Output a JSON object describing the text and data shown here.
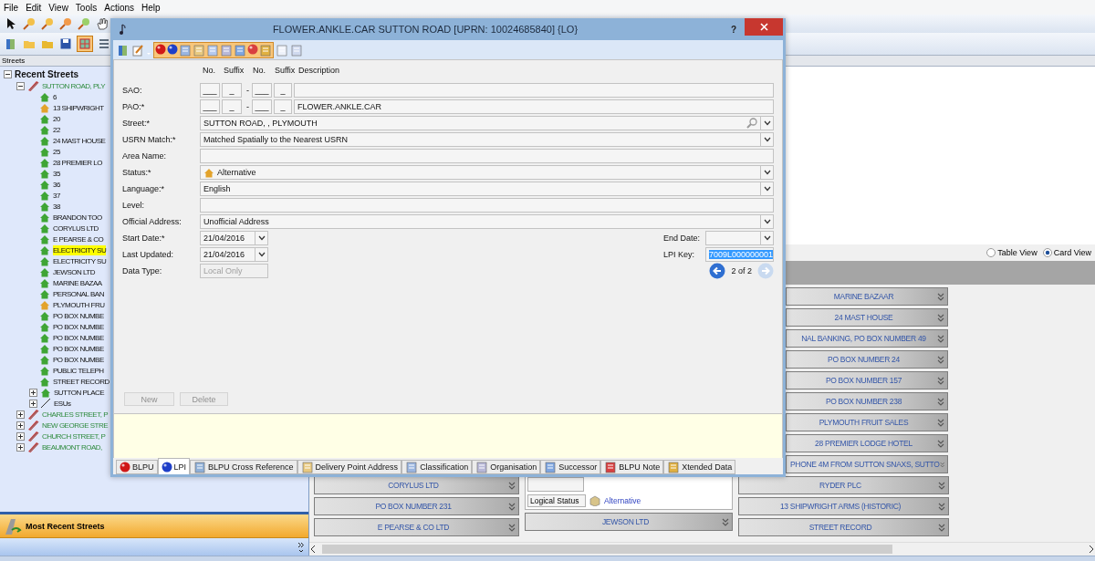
{
  "menu": [
    "File",
    "Edit",
    "View",
    "Tools",
    "Actions",
    "Help"
  ],
  "left_panel": {
    "title": "Streets",
    "tree": {
      "label": "Recent Streets",
      "expanded": true,
      "children": [
        {
          "label": "SUTTON ROAD, PLY",
          "kind": "street",
          "expanded": true,
          "children": [
            {
              "label": "6",
              "kind": "property",
              "color": "#3fa535",
              "selected": false
            },
            {
              "label": "13 SHIPWRIGHT",
              "kind": "property",
              "color": "#e3a32c",
              "selected": false
            },
            {
              "label": "20",
              "kind": "property",
              "color": "#3fa535",
              "selected": false
            },
            {
              "label": "22",
              "kind": "property",
              "color": "#3fa535",
              "selected": false
            },
            {
              "label": "24 MAST HOUSE",
              "kind": "property",
              "color": "#3fa535",
              "selected": false
            },
            {
              "label": "25",
              "kind": "property",
              "color": "#3fa535",
              "selected": false
            },
            {
              "label": "28 PREMIER LO",
              "kind": "property",
              "color": "#3fa535",
              "selected": false
            },
            {
              "label": "35",
              "kind": "property",
              "color": "#3fa535",
              "selected": false
            },
            {
              "label": "36",
              "kind": "property",
              "color": "#3fa535",
              "selected": false
            },
            {
              "label": "37",
              "kind": "property",
              "color": "#3fa535",
              "selected": false
            },
            {
              "label": "38",
              "kind": "property",
              "color": "#3fa535",
              "selected": false
            },
            {
              "label": "BRANDON TOO",
              "kind": "property",
              "color": "#3fa535",
              "selected": false
            },
            {
              "label": "CORYLUS LTD",
              "kind": "property",
              "color": "#3fa535",
              "selected": false
            },
            {
              "label": "E PEARSE & CO",
              "kind": "property",
              "color": "#3fa535",
              "selected": false
            },
            {
              "label": "ELECTRICITY SU",
              "kind": "property",
              "color": "#3fa535",
              "selected": true
            },
            {
              "label": "ELECTRICITY SU",
              "kind": "property",
              "color": "#3fa535",
              "selected": false
            },
            {
              "label": "JEWSON LTD",
              "kind": "property",
              "color": "#3fa535",
              "selected": false
            },
            {
              "label": "MARINE BAZAA",
              "kind": "property",
              "color": "#3fa535",
              "selected": false
            },
            {
              "label": "PERSONAL BAN",
              "kind": "property",
              "color": "#3fa535",
              "selected": false
            },
            {
              "label": "PLYMOUTH FRU",
              "kind": "property",
              "color": "#e3a32c",
              "selected": false
            },
            {
              "label": "PO BOX NUMBE",
              "kind": "property",
              "color": "#3fa535",
              "selected": false
            },
            {
              "label": "PO BOX NUMBE",
              "kind": "property",
              "color": "#3fa535",
              "selected": false
            },
            {
              "label": "PO BOX NUMBE",
              "kind": "property",
              "color": "#3fa535",
              "selected": false
            },
            {
              "label": "PO BOX NUMBE",
              "kind": "property",
              "color": "#3fa535",
              "selected": false
            },
            {
              "label": "PO BOX NUMBE",
              "kind": "property",
              "color": "#3fa535",
              "selected": false
            },
            {
              "label": "PUBLIC TELEPH",
              "kind": "property",
              "color": "#3fa535",
              "selected": false
            },
            {
              "label": "STREET RECORD",
              "kind": "property",
              "color": "#3fa535",
              "selected": false
            },
            {
              "label": "SUTTON PLACE",
              "kind": "property",
              "color": "#3fa535",
              "selected": false,
              "expanded": false
            },
            {
              "label": "ESUs",
              "kind": "esu",
              "selected": false,
              "expanded": false
            }
          ]
        },
        {
          "label": "CHARLES STREET, P",
          "kind": "street",
          "expanded": false
        },
        {
          "label": "NEW GEORGE STRE",
          "kind": "street",
          "expanded": false
        },
        {
          "label": "CHURCH STREET, P",
          "kind": "street",
          "expanded": false
        },
        {
          "label": "BEAUMONT ROAD,",
          "kind": "street",
          "expanded": false
        }
      ]
    },
    "footer_bar": "Most Recent Streets"
  },
  "view_options": [
    {
      "label": "Table View",
      "selected": false
    },
    {
      "label": "Card View",
      "selected": true
    }
  ],
  "cards_right_column": [
    "MARINE BAZAAR",
    "24 MAST HOUSE",
    "NAL BANKING, PO BOX NUMBER 49",
    "PO BOX NUMBER 24",
    "PO BOX NUMBER 157",
    "PO BOX NUMBER 238",
    "PLYMOUTH FRUIT SALES",
    "28 PREMIER LODGE HOTEL",
    "PHONE 4M FROM SUTTON SNAXS, SUTTO"
  ],
  "cards_bottom": {
    "column_1": [
      "CORYLUS LTD",
      "PO BOX NUMBER 231",
      "E PEARSE & CO LTD"
    ],
    "column_2": {
      "detail": {
        "label": "Logical Status",
        "value": "Alternative"
      },
      "cards": [
        "JEWSON LTD"
      ]
    },
    "column_3": [
      "RYDER PLC",
      "13 SHIPWRIGHT ARMS (HISTORIC)",
      "STREET RECORD"
    ]
  },
  "dialog": {
    "title": "FLOWER.ANKLE.CAR SUTTON ROAD [UPRN: 10024685840] {LO}",
    "help": "?",
    "columns": [
      "No.",
      "Suffix",
      "No.",
      "Suffix",
      "Description"
    ],
    "rows": [
      {
        "label": "SAO:",
        "kind": "address",
        "parts": [
          "___",
          "_",
          "___",
          "_"
        ],
        "separator": "-"
      },
      {
        "label": "PAO:*",
        "kind": "address",
        "parts": [
          "___",
          "_",
          "___",
          "_"
        ],
        "separator": "-",
        "value": "FLOWER.ANKLE.CAR"
      },
      {
        "label": "Street:*",
        "kind": "lookup",
        "value": "SUTTON ROAD, , PLYMOUTH"
      },
      {
        "label": "USRN Match:*",
        "kind": "dropdown",
        "value": "Matched Spatially to the Nearest USRN"
      },
      {
        "label": "Area Name:",
        "kind": "text"
      },
      {
        "label": "Status:*",
        "kind": "icon-dropdown",
        "value": "Alternative"
      },
      {
        "label": "Language:*",
        "kind": "dropdown",
        "value": "English"
      },
      {
        "label": "Level:",
        "kind": "text"
      },
      {
        "label": "Official Address:",
        "kind": "dropdown",
        "value": "Unofficial Address"
      }
    ],
    "date_rows": [
      {
        "label": "Start Date:*",
        "value": "21/04/2016",
        "side": {
          "label": "End Date:",
          "kind": "date"
        }
      },
      {
        "label": "Last Updated:",
        "value": "21/04/2016",
        "side": {
          "label": "LPI Key:",
          "kind": "key",
          "value": "7009L000000001",
          "highlighted": true
        }
      }
    ],
    "data_type": {
      "label": "Data Type:",
      "value": "Local Only",
      "disabled": true
    },
    "pager": {
      "text": "2 of 2",
      "prev_disabled": false,
      "next_disabled": true
    },
    "buttons": [
      {
        "label": "New",
        "disabled": true
      },
      {
        "label": "Delete",
        "disabled": true
      }
    ],
    "tabs": [
      {
        "label": "BLPU",
        "selected": false
      },
      {
        "label": "LPI",
        "selected": true
      },
      {
        "label": "BLPU Cross Reference",
        "selected": false
      },
      {
        "label": "Delivery Point Address",
        "selected": false
      },
      {
        "label": "Classification",
        "selected": false
      },
      {
        "label": "Organisation",
        "selected": false
      },
      {
        "label": "Successor",
        "selected": false
      },
      {
        "label": "BLPU Note",
        "selected": false
      },
      {
        "label": "Xtended Data",
        "selected": false
      }
    ]
  }
}
